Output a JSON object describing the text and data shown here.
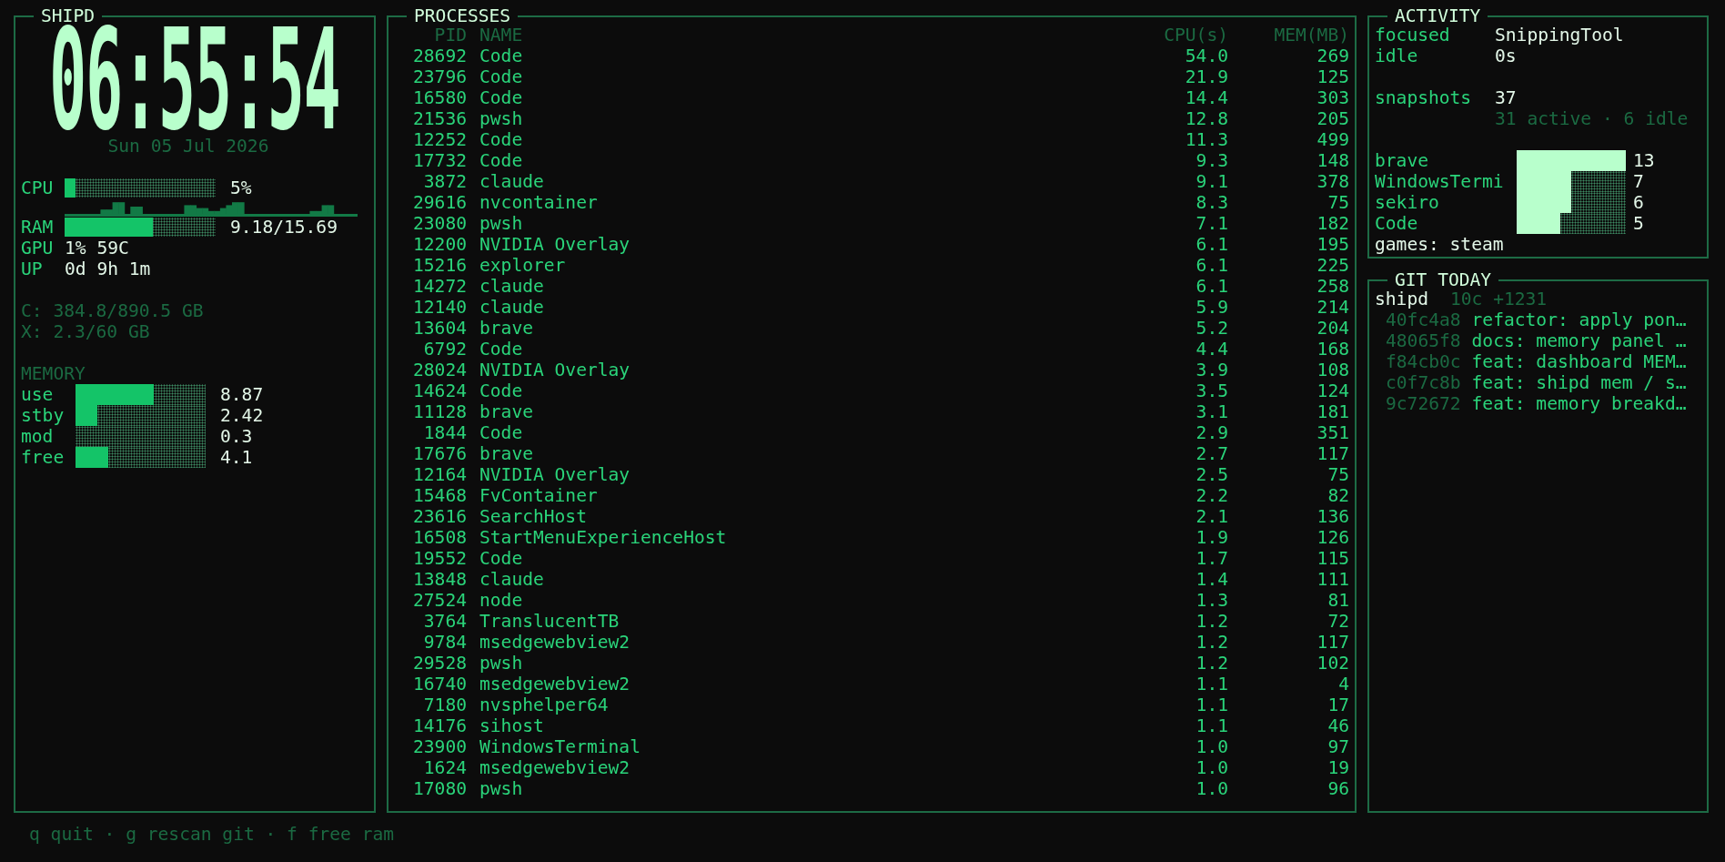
{
  "system": {
    "title": "SHIPD",
    "clock": "06:55:54",
    "date": "Sun 05 Jul 2026",
    "cpu": {
      "label": "CPU",
      "level": 0.07,
      "reading": "5%"
    },
    "ram": {
      "label": "RAM",
      "level": 0.585,
      "reading": "9.18/15.69"
    },
    "stats": [
      {
        "label": "GPU",
        "value": "1% 59C"
      },
      {
        "label": "UP",
        "value": "0d 9h 1m"
      }
    ],
    "disks": [
      "C: 384.8/890.5 GB",
      "X: 2.3/60 GB"
    ],
    "memory": {
      "title": "MEMORY",
      "rows": [
        {
          "label": "use",
          "level": 0.6,
          "reading": "8.87"
        },
        {
          "label": "stby",
          "level": 0.17,
          "reading": "2.42"
        },
        {
          "label": "mod",
          "reading": "0.3"
        },
        {
          "label": "free",
          "level": 0.25,
          "reading": "4.1"
        }
      ]
    }
  },
  "processes": {
    "title": "PROCESSES",
    "columns": [
      "PID",
      "NAME",
      "CPU(s)",
      "MEM(MB)"
    ],
    "rows": [
      [
        "28692",
        "Code",
        "54.0",
        "269"
      ],
      [
        "23796",
        "Code",
        "21.9",
        "125"
      ],
      [
        "16580",
        "Code",
        "14.4",
        "303"
      ],
      [
        "21536",
        "pwsh",
        "12.8",
        "205"
      ],
      [
        "12252",
        "Code",
        "11.3",
        "499"
      ],
      [
        "17732",
        "Code",
        "9.3",
        "148"
      ],
      [
        "3872",
        "claude",
        "9.1",
        "378"
      ],
      [
        "29616",
        "nvcontainer",
        "8.3",
        "75"
      ],
      [
        "23080",
        "pwsh",
        "7.1",
        "182"
      ],
      [
        "12200",
        "NVIDIA Overlay",
        "6.1",
        "195"
      ],
      [
        "15216",
        "explorer",
        "6.1",
        "225"
      ],
      [
        "14272",
        "claude",
        "6.1",
        "258"
      ],
      [
        "12140",
        "claude",
        "5.9",
        "214"
      ],
      [
        "13604",
        "brave",
        "5.2",
        "204"
      ],
      [
        "6792",
        "Code",
        "4.4",
        "168"
      ],
      [
        "28024",
        "NVIDIA Overlay",
        "3.9",
        "108"
      ],
      [
        "14624",
        "Code",
        "3.5",
        "124"
      ],
      [
        "11128",
        "brave",
        "3.1",
        "181"
      ],
      [
        "1844",
        "Code",
        "2.9",
        "351"
      ],
      [
        "17676",
        "brave",
        "2.7",
        "117"
      ],
      [
        "12164",
        "NVIDIA Overlay",
        "2.5",
        "75"
      ],
      [
        "15468",
        "FvContainer",
        "2.2",
        "82"
      ],
      [
        "23616",
        "SearchHost",
        "2.1",
        "136"
      ],
      [
        "16508",
        "StartMenuExperienceHost",
        "1.9",
        "126"
      ],
      [
        "19552",
        "Code",
        "1.7",
        "115"
      ],
      [
        "13848",
        "claude",
        "1.4",
        "111"
      ],
      [
        "27524",
        "node",
        "1.3",
        "81"
      ],
      [
        "3764",
        "TranslucentTB",
        "1.2",
        "72"
      ],
      [
        "9784",
        "msedgewebview2",
        "1.2",
        "117"
      ],
      [
        "29528",
        "pwsh",
        "1.2",
        "102"
      ],
      [
        "16740",
        "msedgewebview2",
        "1.1",
        "4"
      ],
      [
        "7180",
        "nvsphelper64",
        "1.1",
        "17"
      ],
      [
        "14176",
        "sihost",
        "1.1",
        "46"
      ],
      [
        "23900",
        "WindowsTerminal",
        "1.0",
        "97"
      ],
      [
        "1624",
        "msedgewebview2",
        "1.0",
        "19"
      ],
      [
        "17080",
        "pwsh",
        "1.0",
        "96"
      ]
    ]
  },
  "activity": {
    "title": "ACTIVITY",
    "rows": [
      {
        "label": "focused",
        "value": "SnippingTool"
      },
      {
        "label": "idle",
        "value": "0s"
      }
    ],
    "snapshots": {
      "label": "snapshots",
      "value": "37",
      "detail": "31 active · 6 idle"
    },
    "apps": [
      {
        "name": "brave",
        "level": 1,
        "count": "13"
      },
      {
        "name": "WindowsTermi",
        "level": 0.5,
        "count": "7"
      },
      {
        "name": "sekiro",
        "level": 0.5,
        "count": "6"
      },
      {
        "name": "Code",
        "level": 0.4,
        "count": "5"
      }
    ],
    "games": "games: steam"
  },
  "git": {
    "title": "GIT TODAY",
    "repos": [
      {
        "name": "shipd",
        "summary": "10c +1231",
        "commits": [
          {
            "hash": "40fc4a8",
            "message": "refactor: apply pon…"
          },
          {
            "hash": "48065f8",
            "message": "docs: memory panel …"
          },
          {
            "hash": "f84cb0c",
            "message": "feat: dashboard MEM…"
          },
          {
            "hash": "c0f7c8b",
            "message": "feat: shipd mem / s…"
          },
          {
            "hash": "9c72672",
            "message": "feat: memory breakd…"
          }
        ]
      }
    ]
  },
  "footer": "q quit · g rescan git · f free ram"
}
